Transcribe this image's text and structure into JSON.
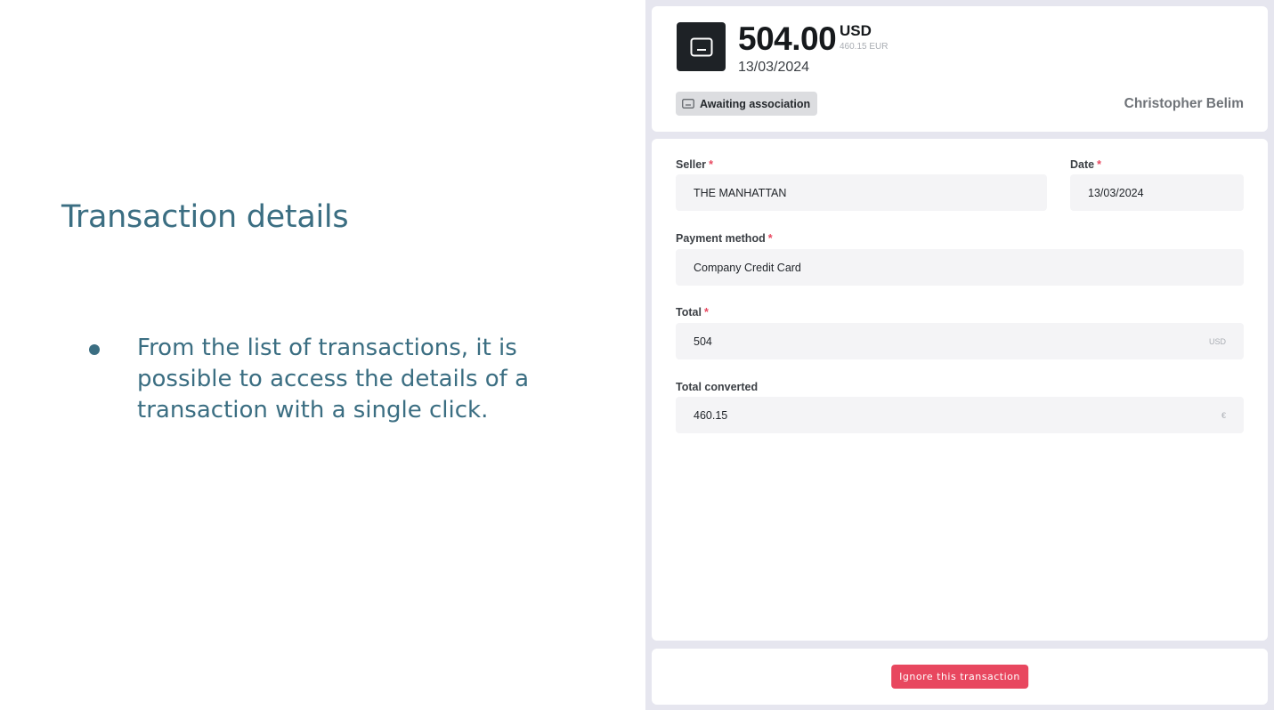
{
  "slide": {
    "quote_glyph": "“",
    "title": "Transaction details",
    "bullets": [
      "From the list of transactions, it is possible to access the details of a transaction with a single click."
    ]
  },
  "transaction": {
    "icon": "receipt-icon",
    "amount": "504.00",
    "currency": "USD",
    "converted_amount": "460.15 EUR",
    "date": "13/03/2024",
    "status": {
      "icon": "receipt-icon",
      "label": "Awaiting association"
    },
    "user_name": "Christopher Belim"
  },
  "form": {
    "seller": {
      "label": "Seller",
      "required_mark": "*",
      "value": "THE MANHATTAN"
    },
    "date": {
      "label": "Date",
      "required_mark": "*",
      "value": "13/03/2024"
    },
    "payment_method": {
      "label": "Payment method",
      "required_mark": "*",
      "value": "Company Credit Card"
    },
    "total": {
      "label": "Total",
      "required_mark": "*",
      "value": "504",
      "unit": "USD"
    },
    "total_converted": {
      "label": "Total converted",
      "value": "460.15",
      "unit": "€"
    }
  },
  "footer": {
    "ignore_label": "Ignore this transaction"
  },
  "colors": {
    "accent": "#e8475f",
    "slide_text": "#3b6e82",
    "panel_background": "#e6e6ef",
    "icon_box": "#1e2226"
  }
}
